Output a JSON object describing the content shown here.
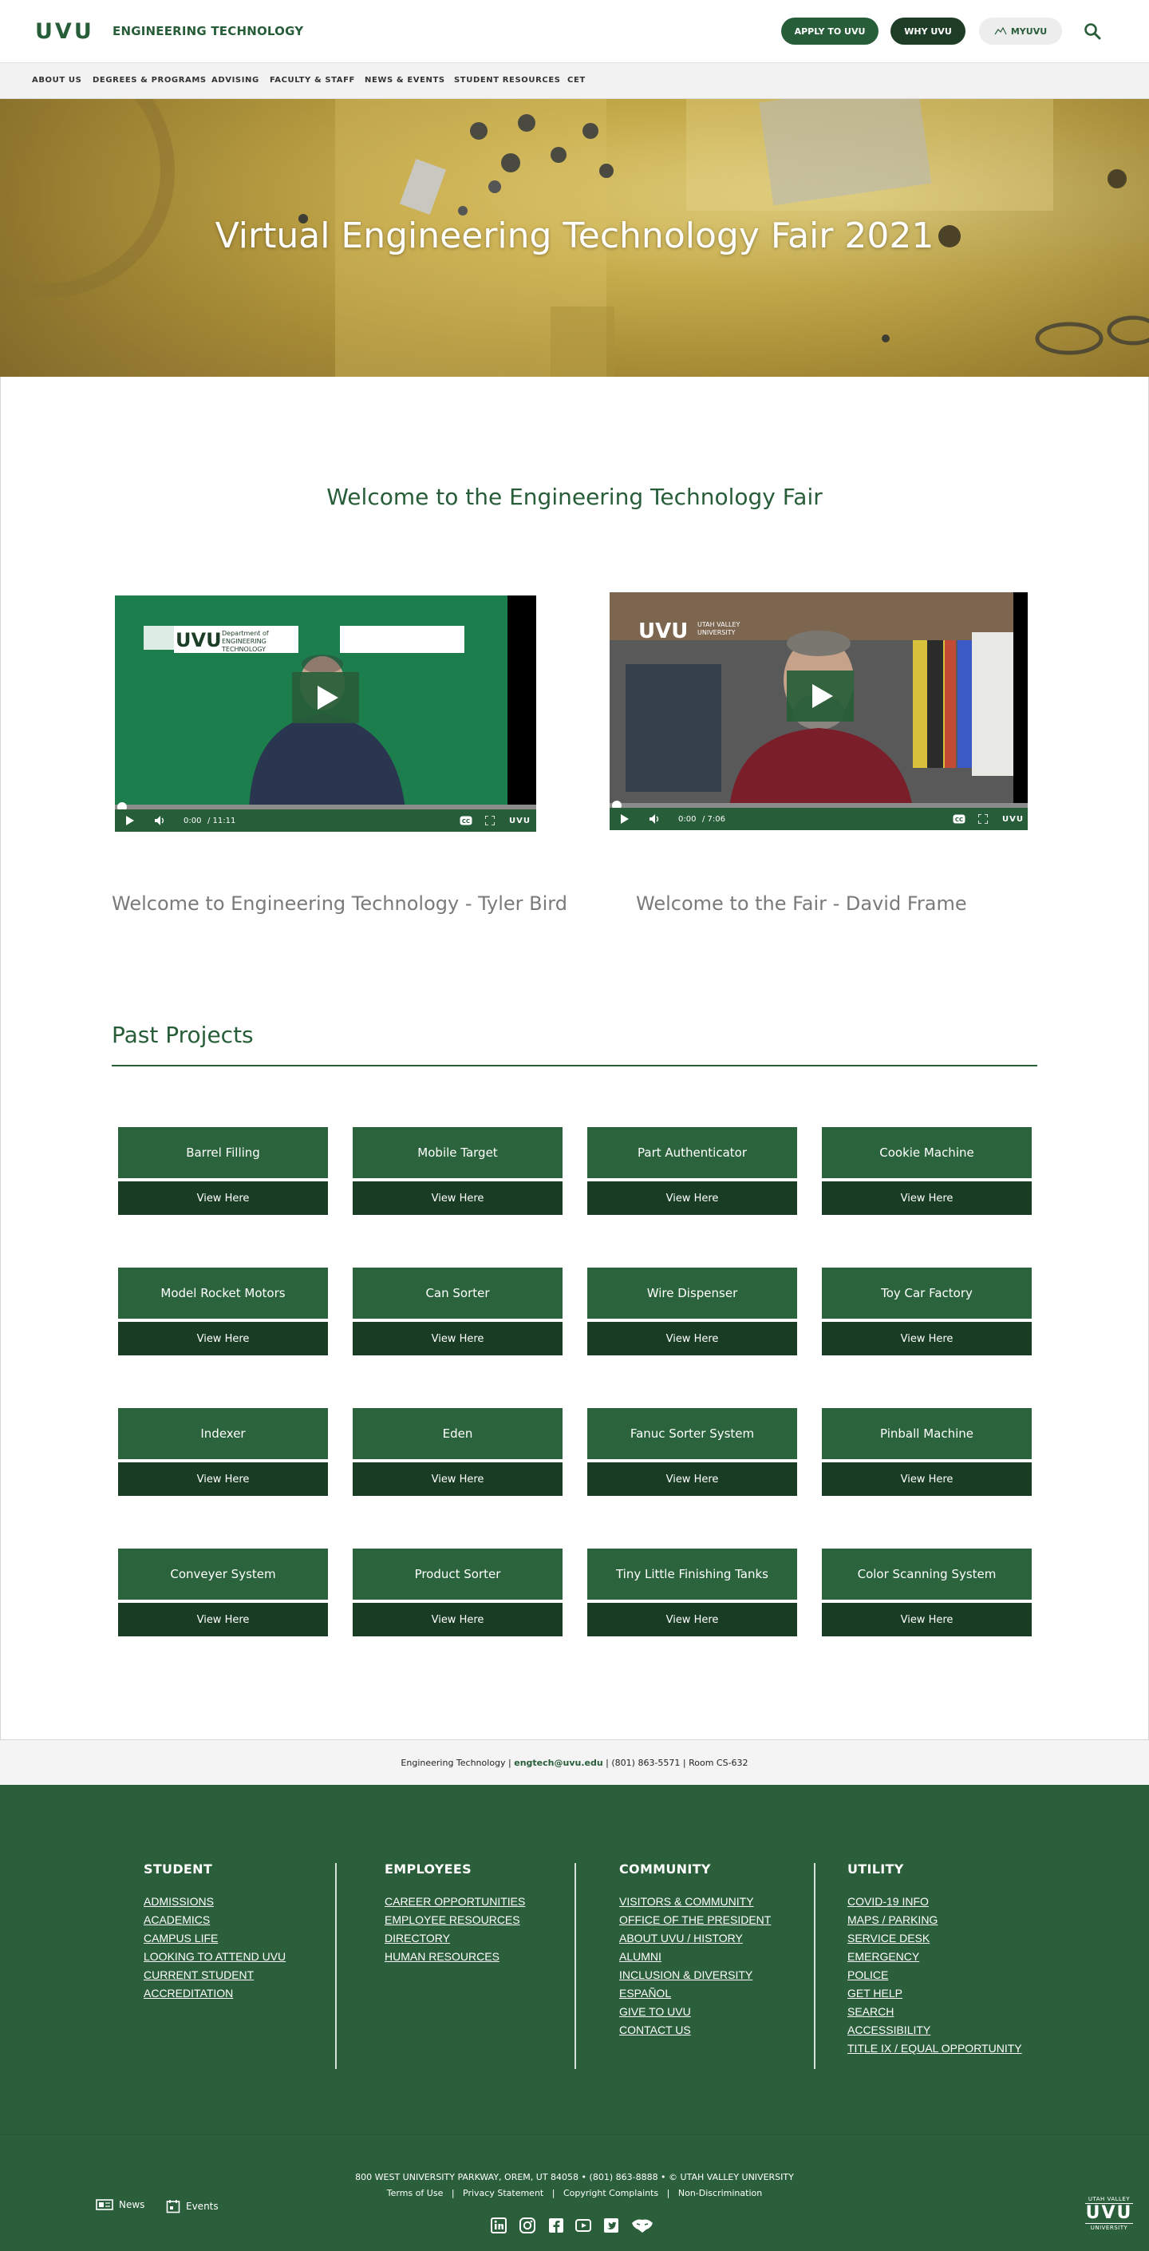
{
  "header": {
    "logo": "UVU",
    "department": "ENGINEERING TECHNOLOGY",
    "apply_label": "APPLY TO UVU",
    "why_label": "WHY UVU",
    "myuvu_label": "MYUVU",
    "search_icon": "search-icon"
  },
  "nav": {
    "items": [
      "ABOUT US",
      "DEGREES & PROGRAMS",
      "ADVISING",
      "FACULTY & STAFF",
      "NEWS & EVENTS",
      "STUDENT RESOURCES",
      "CET"
    ]
  },
  "hero": {
    "title": "Virtual Engineering Technology Fair 2021"
  },
  "welcome": {
    "heading": "Welcome to the Engineering Technology Fair"
  },
  "videos": [
    {
      "caption": "Welcome to Engineering Technology - Tyler Bird",
      "current_time": "0:00",
      "duration": "/ 11:11",
      "logo": "UVU",
      "slide_logo": "UVU",
      "slide_dept": "Department of ENGINEERING TECHNOLOGY"
    },
    {
      "caption": "Welcome to the Fair - David Frame",
      "current_time": "0:00",
      "duration": "/ 7:06",
      "logo": "UVU",
      "slide_logo": "UVU",
      "slide_dept": "UTAH VALLEY UNIVERSITY"
    }
  ],
  "past_projects": {
    "heading": "Past Projects",
    "button_label": "View Here",
    "items": [
      "Barrel Filling",
      "Mobile Target",
      "Part Authenticator",
      "Cookie Machine",
      "Model Rocket Motors",
      "Can Sorter",
      "Wire Dispenser",
      "Toy Car Factory",
      "Indexer",
      "Eden",
      "Fanuc Sorter System",
      "Pinball Machine",
      "Conveyer System",
      "Product Sorter",
      "Tiny Little Finishing Tanks",
      "Color Scanning System"
    ]
  },
  "contact": {
    "dept": "Engineering Technology | ",
    "email": "engtech@uvu.edu",
    "rest": " | (801) 863-5571 | Room CS-632"
  },
  "footer": {
    "columns": [
      {
        "title": "STUDENT",
        "links": [
          "ADMISSIONS",
          "ACADEMICS",
          "CAMPUS LIFE",
          "LOOKING TO ATTEND UVU",
          "CURRENT STUDENT",
          "ACCREDITATION"
        ]
      },
      {
        "title": "EMPLOYEES",
        "links": [
          "CAREER OPPORTUNITIES",
          "EMPLOYEE RESOURCES",
          "DIRECTORY",
          "HUMAN RESOURCES"
        ]
      },
      {
        "title": "COMMUNITY",
        "links": [
          "VISITORS & COMMUNITY",
          "OFFICE OF THE PRESIDENT",
          "ABOUT UVU / HISTORY",
          "ALUMNI",
          "INCLUSION & DIVERSITY",
          "ESPAÑOL",
          "GIVE TO UVU",
          "CONTACT US"
        ]
      },
      {
        "title": "UTILITY",
        "links": [
          "COVID-19 INFO",
          "MAPS / PARKING",
          "SERVICE DESK",
          "EMERGENCY",
          "POLICE",
          "GET HELP",
          "SEARCH",
          "ACCESSIBILITY",
          "TITLE IX / EQUAL OPPORTUNITY"
        ]
      }
    ],
    "address": "800 WEST UNIVERSITY PARKWAY, OREM, UT 84058  •  (801) 863-8888  •  © UTAH VALLEY UNIVERSITY",
    "legal_links": [
      "Terms of Use",
      "Privacy Statement",
      "Copyright Complaints",
      "Non-Discrimination"
    ],
    "news_label": "News",
    "events_label": "Events",
    "social_icons": [
      "linkedin-icon",
      "instagram-icon",
      "facebook-icon",
      "youtube-icon",
      "twitter-icon",
      "wolverine-icon"
    ],
    "bottom_logo_top": "UTAH VALLEY",
    "bottom_logo": "UVU",
    "bottom_logo_bottom": "UNIVERSITY"
  },
  "colors": {
    "brand_green": "#275d38",
    "dark_green": "#183c24",
    "footer_green": "#2b5e3b"
  }
}
